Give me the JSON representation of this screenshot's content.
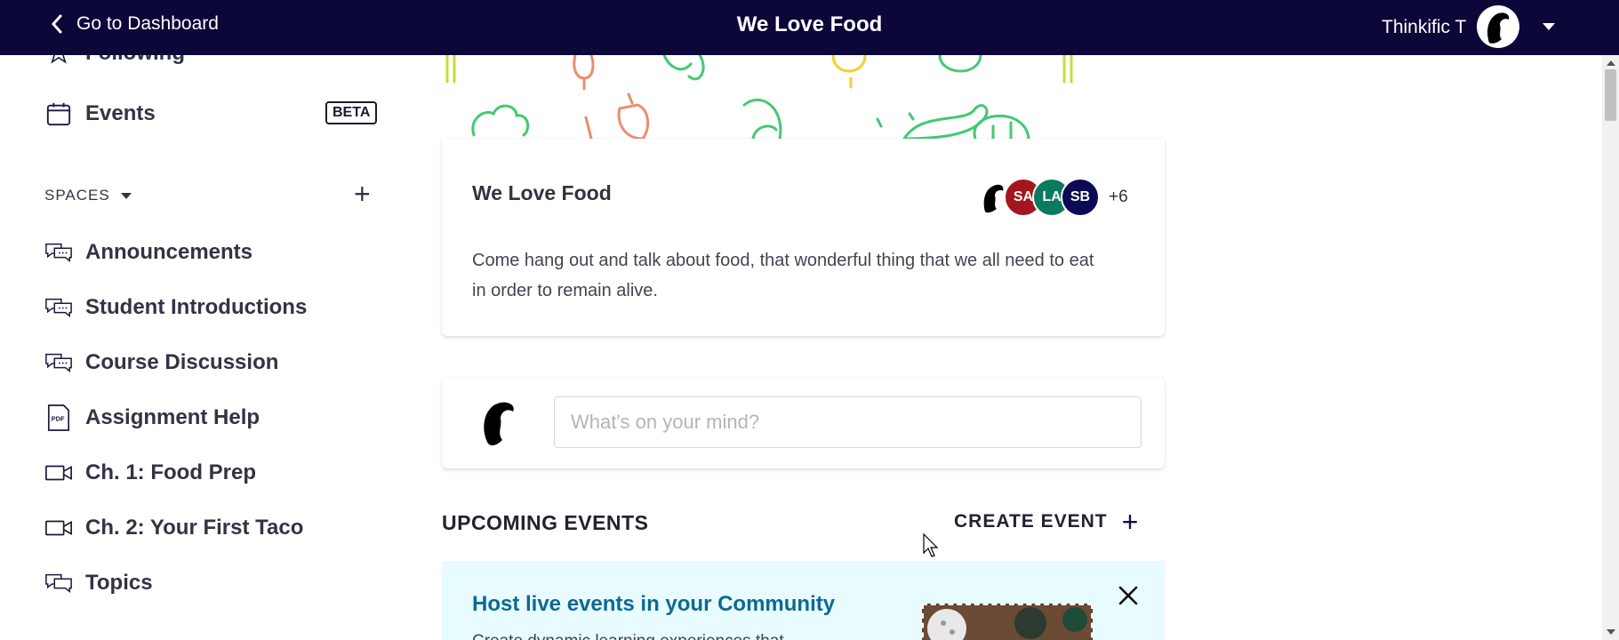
{
  "topbar": {
    "back_label": "Go to Dashboard",
    "title": "We Love Food",
    "user_name": "Thinkific T"
  },
  "sidebar": {
    "following_label": "Following",
    "events_label": "Events",
    "events_badge": "BETA",
    "spaces_header": "SPACES",
    "spaces": [
      {
        "label": "Announcements",
        "icon": "chat-bubbles-icon"
      },
      {
        "label": "Student Introductions",
        "icon": "chat-bubbles-icon"
      },
      {
        "label": "Course Discussion",
        "icon": "chat-bubbles-icon"
      },
      {
        "label": "Assignment Help",
        "icon": "pdf-icon"
      },
      {
        "label": "Ch. 1: Food Prep",
        "icon": "video-icon"
      },
      {
        "label": "Ch. 2: Your First Taco",
        "icon": "video-icon"
      },
      {
        "label": "Topics",
        "icon": "chat-bubbles-icon"
      }
    ]
  },
  "space_card": {
    "title": "We Love Food",
    "description": "Come hang out and talk about food, that wonderful thing that we all need to eat in order to remain alive.",
    "members": [
      {
        "initials": "",
        "color": "#ffffff"
      },
      {
        "initials": "SA",
        "color": "#a4161f"
      },
      {
        "initials": "LA",
        "color": "#0b7a5e"
      },
      {
        "initials": "SB",
        "color": "#0b0a52"
      }
    ],
    "more_count": "+6"
  },
  "composer": {
    "placeholder": "What's on your mind?"
  },
  "events_section": {
    "heading": "UPCOMING EVENTS",
    "create_label": "CREATE EVENT"
  },
  "promo": {
    "title": "Host live events in your Community",
    "subtitle": "Create dynamic learning experiences that"
  },
  "colors": {
    "topbar_bg": "#0b0738",
    "promo_bg": "#e8fbff",
    "promo_title": "#0a6a93",
    "accent": "#120b5a"
  }
}
